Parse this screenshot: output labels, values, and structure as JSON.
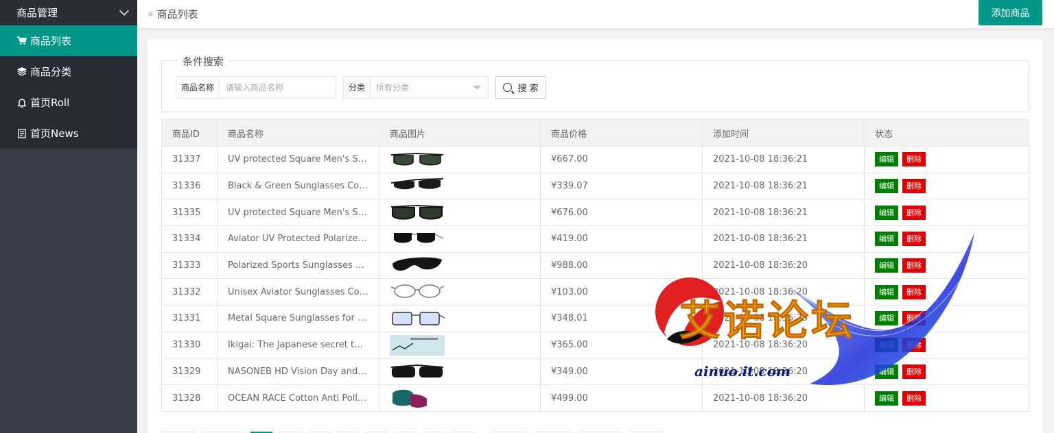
{
  "sidebar": {
    "header": "商品管理",
    "items": [
      {
        "label": "商品列表",
        "icon": "cart-icon",
        "active": true
      },
      {
        "label": "商品分类",
        "icon": "layers-icon",
        "active": false
      },
      {
        "label": "首页Roll",
        "icon": "bell-icon",
        "active": false
      },
      {
        "label": "首页News",
        "icon": "document-icon",
        "active": false
      }
    ]
  },
  "topbar": {
    "breadcrumb_sep": "»",
    "breadcrumb": "商品列表",
    "add_button": "添加商品"
  },
  "search": {
    "legend": "条件搜索",
    "name_label": "商品名称",
    "name_placeholder": "请输入商品名称",
    "category_label": "分类",
    "category_value": "所有分类",
    "button": "搜 索"
  },
  "table": {
    "headers": [
      "商品ID",
      "商品名称",
      "商品图片",
      "商品价格",
      "添加时间",
      "状态"
    ],
    "edit_label": "编辑",
    "delete_label": "删除",
    "rows": [
      {
        "id": "31337",
        "name": "UV protected Square Men's Sunglasses",
        "price": "¥667.00",
        "time": "2021-10-08 18:36:21"
      },
      {
        "id": "31336",
        "name": "Black & Green Sunglasses Combo",
        "price": "¥339.07",
        "time": "2021-10-08 18:36:21"
      },
      {
        "id": "31335",
        "name": "UV protected Square Men's Sunglasses",
        "price": "¥676.00",
        "time": "2021-10-08 18:36:21"
      },
      {
        "id": "31334",
        "name": "Aviator UV Protected Polarized Black",
        "price": "¥419.00",
        "time": "2021-10-08 18:36:21"
      },
      {
        "id": "31333",
        "name": "Polarized Sports Sunglasses Mirrored",
        "price": "¥988.00",
        "time": "2021-10-08 18:36:20"
      },
      {
        "id": "31332",
        "name": "Unisex Aviator Sunglasses Combo",
        "price": "¥103.00",
        "time": "2021-10-08 18:36:20"
      },
      {
        "id": "31331",
        "name": "Metal Square Sunglasses for Men",
        "price": "¥348.01",
        "time": "2021-10-08 18:36:20"
      },
      {
        "id": "31330",
        "name": "Ikigai: The Japanese secret to a long life",
        "price": "¥365.00",
        "time": "2021-10-08 18:36:20"
      },
      {
        "id": "31329",
        "name": "NASONEB HD Vision Day and Night",
        "price": "¥349.00",
        "time": "2021-10-08 18:36:20"
      },
      {
        "id": "31328",
        "name": "OCEAN RACE Cotton Anti Pollution Mask",
        "price": "¥499.00",
        "time": "2021-10-08 18:36:20"
      }
    ]
  },
  "watermark": {
    "text": "艾诺论坛",
    "url": "ainuo.it.com"
  },
  "colors": {
    "accent": "#009688",
    "sidebar": "#393d49",
    "edit": "#008000",
    "delete": "#e00000"
  }
}
